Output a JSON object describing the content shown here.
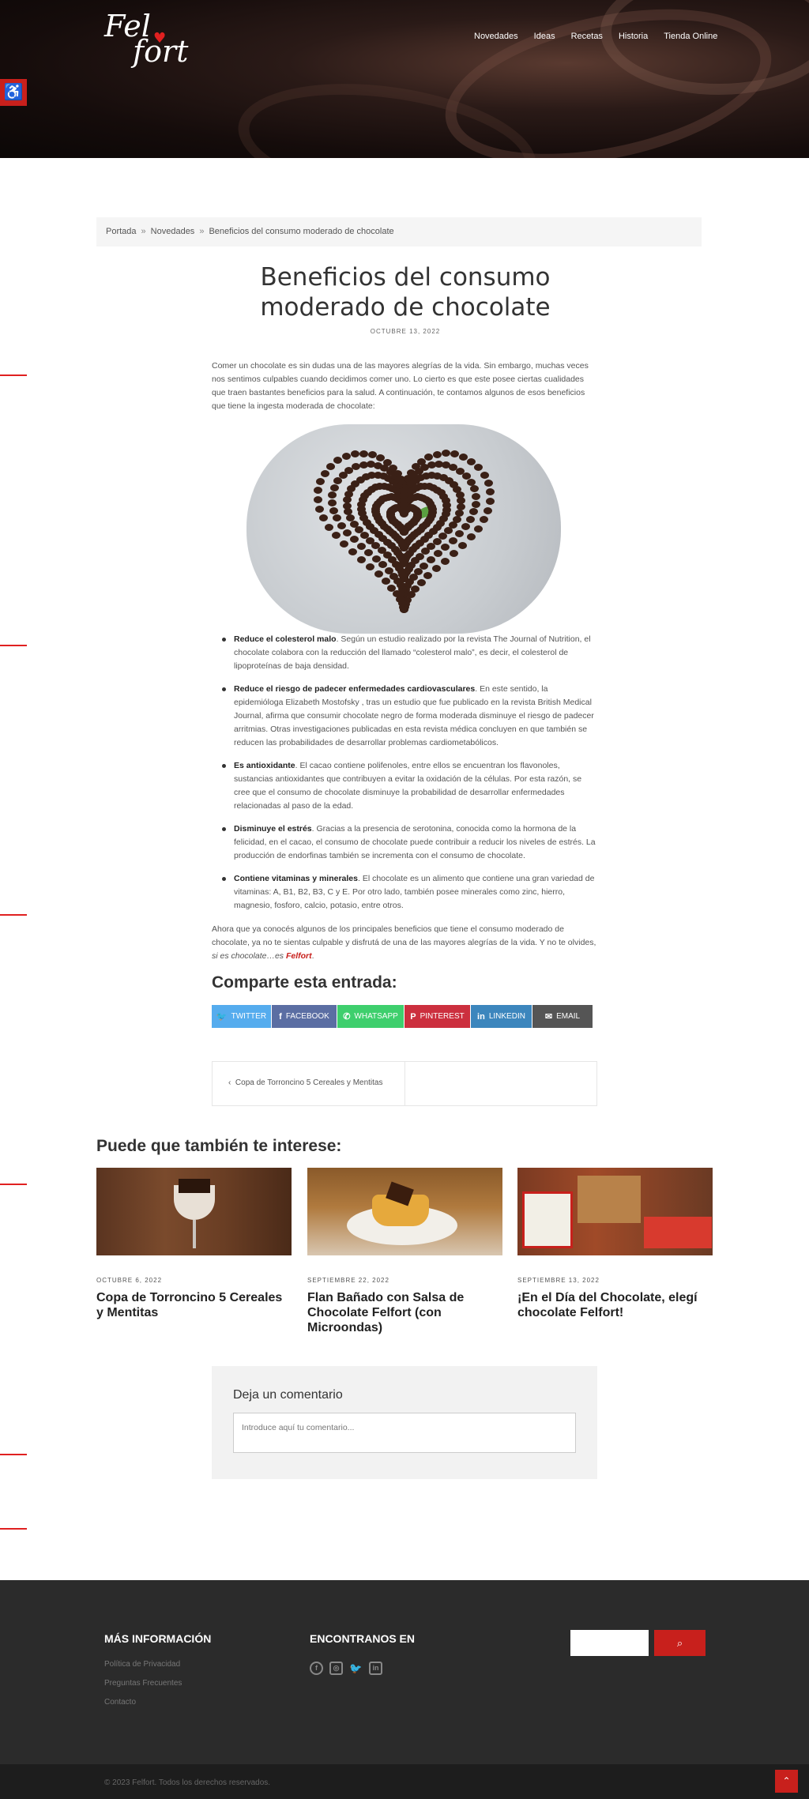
{
  "header": {
    "logo_line1": "Fel",
    "logo_line2": "fort",
    "nav": [
      "Novedades",
      "Ideas",
      "Recetas",
      "Historia",
      "Tienda Online"
    ]
  },
  "breadcrumb": [
    "Portada",
    "Novedades",
    "Beneficios del consumo moderado de chocolate"
  ],
  "article": {
    "title": "Beneficios del consumo moderado de chocolate",
    "date": "OCTUBRE 13, 2022",
    "intro": "Comer un chocolate es sin dudas una de las mayores alegrías de la vida. Sin embargo, muchas veces nos sentimos culpables cuando decidimos comer uno. Lo cierto es que este posee ciertas cualidades que traen bastantes beneficios para la salud. A continuación, te contamos algunos de esos beneficios que tiene la ingesta moderada de chocolate:",
    "bullets": [
      {
        "bold": "Reduce el colesterol malo",
        "text": ". Según un estudio realizado por la revista The Journal of Nutrition, el chocolate colabora con la reducción del llamado “colesterol malo”, es decir, el colesterol de lipoproteínas de baja densidad."
      },
      {
        "bold": "Reduce el riesgo de padecer enfermedades cardiovasculares",
        "text": ". En este sentido, la epidemióloga Elizabeth Mostofsky , tras un estudio que fue publicado en la revista British Medical Journal, afirma que consumir chocolate negro de forma moderada disminuye el riesgo de padecer arritmias. Otras investigaciones publicadas en esta revista médica concluyen en que también se reducen las probabilidades de desarrollar problemas cardiometabólicos."
      },
      {
        "bold": "Es antioxidante",
        "text": ". El cacao contiene polifenoles, entre ellos se encuentran los flavonoles, sustancias antioxidantes que contribuyen a evitar la oxidación de la células. Por esta razón, se cree que el consumo de chocolate disminuye la probabilidad de desarrollar enfermedades relacionadas al paso de la edad."
      },
      {
        "bold": "Disminuye el estrés",
        "text": ". Gracias a la presencia de serotonina, conocida como la hormona de la felicidad, en el cacao, el consumo de chocolate puede contribuir a reducir los niveles de estrés. La producción de endorfinas también se incrementa con el consumo de chocolate."
      },
      {
        "bold": "Contiene vitaminas y minerales",
        "text": ". El chocolate es un alimento que contiene una gran variedad de vitaminas: A, B1, B2, B3, C y E. Por otro lado, también posee minerales como zinc, hierro, magnesio, fosforo, calcio, potasio, entre otros."
      }
    ],
    "outro": "Ahora que ya conocés algunos de los principales beneficios que tiene el consumo moderado de chocolate, ya no te sientas culpable y disfrutá de una de las mayores alegrías de la vida. Y no te olvides,",
    "outro_italic": "si es chocolate…es",
    "outro_brand": "Felfort",
    "outro_end": "."
  },
  "share": {
    "heading": "Comparte esta entrada:",
    "buttons": [
      {
        "label": "TWITTER",
        "icon": "twitter-icon",
        "color": "#55acee"
      },
      {
        "label": "FACEBOOK",
        "icon": "facebook-icon",
        "color": "#5b6ea3"
      },
      {
        "label": "WHATSAPP",
        "icon": "whatsapp-icon",
        "color": "#3ecf6d"
      },
      {
        "label": "PINTEREST",
        "icon": "pinterest-icon",
        "color": "#cc2f3e"
      },
      {
        "label": "LINKEDIN",
        "icon": "linkedin-icon",
        "color": "#3c86bd"
      },
      {
        "label": "EMAIL",
        "icon": "envelope-icon",
        "color": "#555555"
      }
    ]
  },
  "postnav": {
    "prev": "Copa de Torroncino 5 Cereales y Mentitas"
  },
  "related": {
    "heading": "Puede que también te interese:",
    "cards": [
      {
        "date": "OCTUBRE 6, 2022",
        "title": "Copa de Torroncino 5 Cereales y Mentitas"
      },
      {
        "date": "SEPTIEMBRE 22, 2022",
        "title": "Flan Bañado con Salsa de Chocolate Felfort (con Microondas)"
      },
      {
        "date": "SEPTIEMBRE 13, 2022",
        "title": "¡En el Día del Chocolate, elegí chocolate Felfort!"
      }
    ]
  },
  "comment": {
    "heading": "Deja un comentario",
    "placeholder": "Introduce aquí tu comentario..."
  },
  "footer": {
    "info_heading": "MÁS INFORMACIÓN",
    "links": [
      "Política de Privacidad",
      "Preguntas Frecuentes",
      "Contacto"
    ],
    "social_heading": "ENCONTRANOS EN",
    "copyright": "© 2023 Felfort. Todos los derechos reservados."
  },
  "colors": {
    "accent": "#c8201c",
    "footer": "#2b2b2b"
  }
}
